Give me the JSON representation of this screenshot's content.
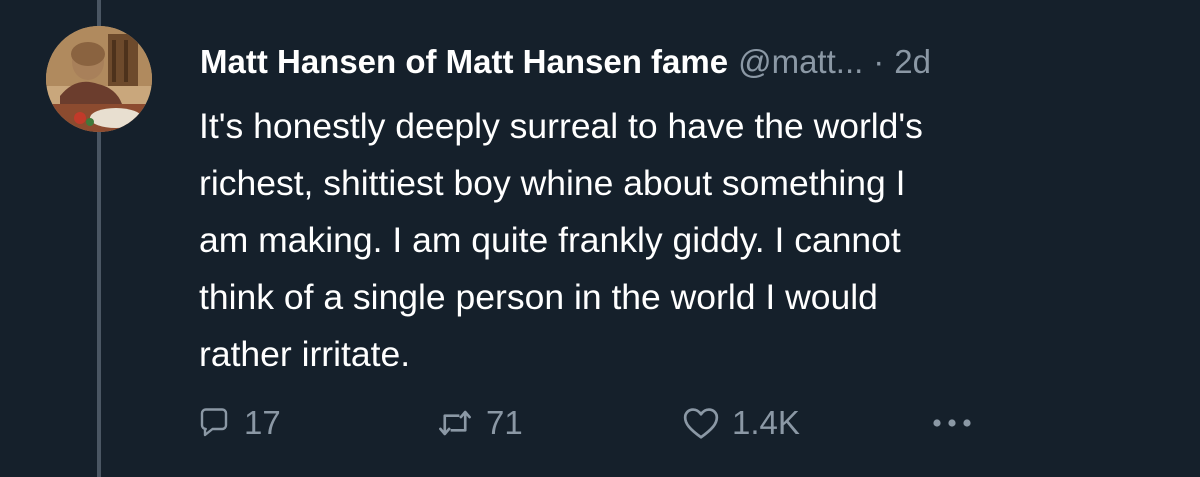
{
  "tweet": {
    "author_name": "Matt Hansen of Matt Hansen fame",
    "author_handle": "@matt...",
    "separator": "·",
    "timestamp": "2d",
    "lines": [
      "It's honestly deeply surreal to have the world's",
      "richest, shittiest boy whine about something I",
      "am making. I am quite frankly giddy. I cannot",
      "think of a single person in the world I would",
      "rather irritate."
    ]
  },
  "actions": {
    "reply_count": "17",
    "retweet_count": "71",
    "like_count": "1.4K"
  },
  "icons": {
    "reply": "reply-icon",
    "retweet": "retweet-icon",
    "like": "heart-icon",
    "more": "more-icon"
  },
  "colors": {
    "background": "#15202b",
    "primary_text": "#ffffff",
    "secondary_text": "#8b98a5",
    "thread_line": "#4a5663"
  }
}
